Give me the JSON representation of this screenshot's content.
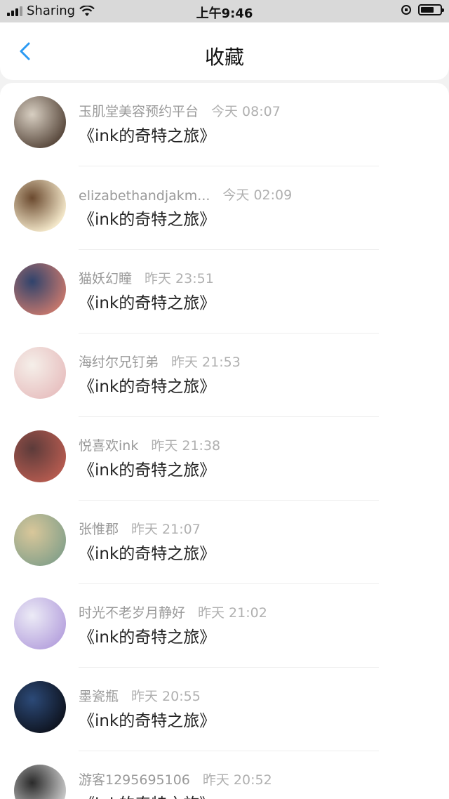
{
  "status_bar": {
    "carrier": "Sharing",
    "time": "上午9:46",
    "battery_percent": 70
  },
  "header": {
    "title": "收藏"
  },
  "favorites": [
    {
      "name": "玉肌堂美容预约平台",
      "time": "今天 08:07",
      "title": "《ink的奇特之旅》",
      "avatar_colors": [
        "#5b4b3f",
        "#d8cfc2"
      ]
    },
    {
      "name": "elizabethandjakm...",
      "time": "今天 02:09",
      "title": "《ink的奇特之旅》",
      "avatar_colors": [
        "#f3e7c9",
        "#6b4a2f"
      ]
    },
    {
      "name": "猫妖幻瞳",
      "time": "昨天 23:51",
      "title": "《ink的奇特之旅》",
      "avatar_colors": [
        "#c2766d",
        "#30436c"
      ]
    },
    {
      "name": "海纣尔兄钉弟",
      "time": "昨天 21:53",
      "title": "《ink的奇特之旅》",
      "avatar_colors": [
        "#e8c2c2",
        "#f5efe9"
      ]
    },
    {
      "name": "悦喜欢ink",
      "time": "昨天 21:38",
      "title": "《ink的奇特之旅》",
      "avatar_colors": [
        "#b35a4f",
        "#5c3b3a"
      ]
    },
    {
      "name": "张惟郡",
      "time": "昨天 21:07",
      "title": "《ink的奇特之旅》",
      "avatar_colors": [
        "#8aa38b",
        "#d9c79a"
      ]
    },
    {
      "name": "时光不老岁月静好",
      "time": "昨天 21:02",
      "title": "《ink的奇特之旅》",
      "avatar_colors": [
        "#b9a6df",
        "#ecebf6"
      ]
    },
    {
      "name": "墨瓷瓶",
      "time": "昨天 20:55",
      "title": "《ink的奇特之旅》",
      "avatar_colors": [
        "#0f1522",
        "#2c4a78"
      ]
    },
    {
      "name": "游客1295695106",
      "time": "昨天 20:52",
      "title": "《ink的奇特之旅》",
      "avatar_colors": [
        "#c9c9c9",
        "#2a2a2a"
      ]
    }
  ]
}
